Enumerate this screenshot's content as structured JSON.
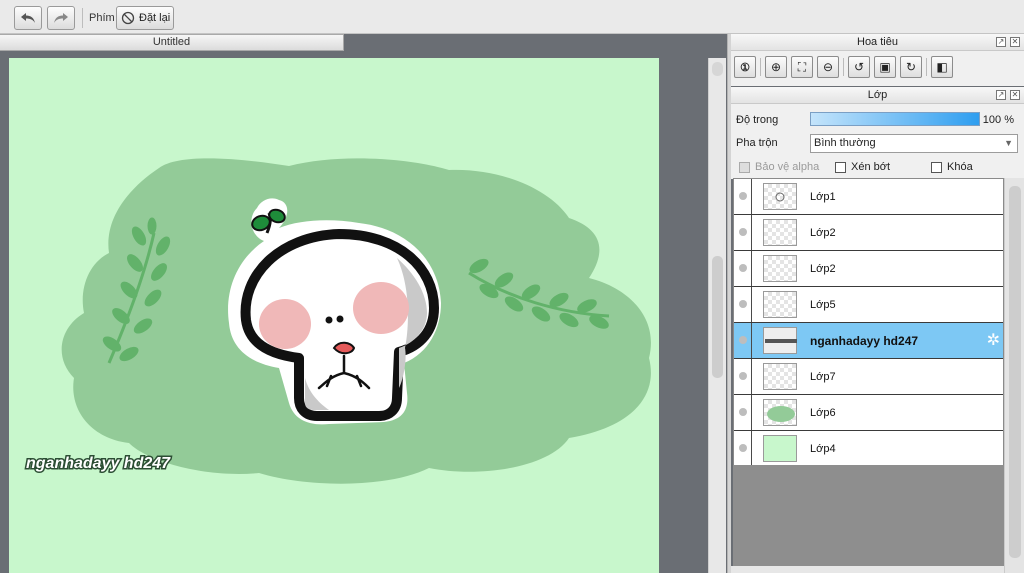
{
  "toolbar": {
    "undo_icon": "undo-arrow",
    "redo_icon": "redo-arrow",
    "shortcut_label": "Phím",
    "reset_label": "Đặt lại"
  },
  "document": {
    "tab_title": "Untitled"
  },
  "canvas": {
    "background": "#c8f7cc",
    "blob_color": "#93cb98",
    "leaf_color": "#62b26a",
    "watermark": "nganhadayy hd247"
  },
  "navigator": {
    "title": "Hoa tiêu",
    "buttons": [
      "zoom-actual-icon",
      "zoom-in-icon",
      "fit-screen-icon",
      "zoom-out-icon",
      "rotate-left-icon",
      "fit-full-icon",
      "rotate-right-icon",
      "flip-icon"
    ]
  },
  "layer_panel": {
    "title": "Lớp",
    "opacity_label": "Độ trong",
    "opacity_value": "100 %",
    "opacity": 1.0,
    "blend_label": "Pha trộn",
    "blend_value": "Bình thường",
    "checks": [
      {
        "label": "Bảo vệ alpha",
        "disabled": true
      },
      {
        "label": "Xén bớt",
        "disabled": false
      },
      {
        "label": "Khóa",
        "disabled": false
      }
    ],
    "layers": [
      {
        "name": "Lớp1",
        "thumb": "checker"
      },
      {
        "name": "Lớp2",
        "thumb": "checker"
      },
      {
        "name": "Lớp2",
        "thumb": "checker"
      },
      {
        "name": "Lớp5",
        "thumb": "checker"
      },
      {
        "name": "nganhadayy hd247",
        "thumb": "text",
        "selected": true
      },
      {
        "name": "Lớp7",
        "thumb": "checker"
      },
      {
        "name": "Lớp6",
        "thumb": "blob"
      },
      {
        "name": "Lớp4",
        "thumb": "green"
      }
    ],
    "selected_color": "#7dc8f4"
  }
}
